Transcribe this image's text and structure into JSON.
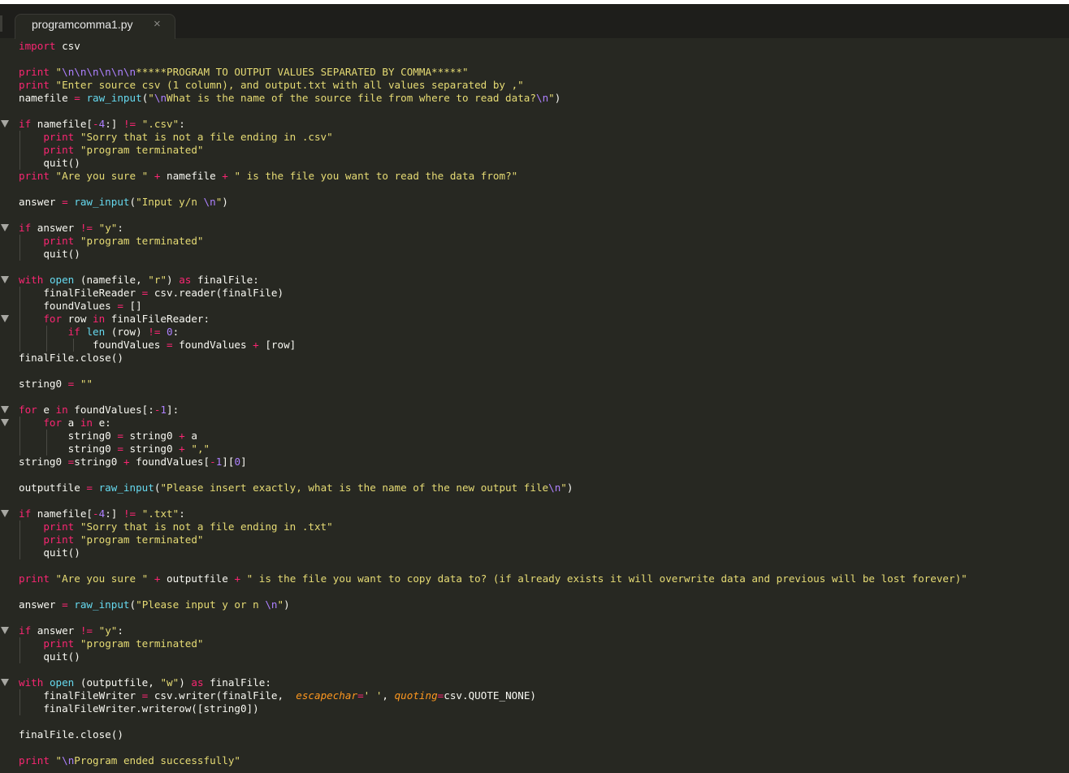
{
  "tab": {
    "filename": "programcomma1.py",
    "close_glyph": "×"
  },
  "code_lines": [
    [
      [
        "kw",
        "import"
      ],
      [
        "tx",
        " csv"
      ]
    ],
    [],
    [
      [
        "kw",
        "print"
      ],
      [
        "tx",
        " "
      ],
      [
        "st",
        "\""
      ],
      [
        "es",
        "\\n\\n\\n\\n\\n\\n"
      ],
      [
        "st",
        "*****PROGRAM TO OUTPUT VALUES SEPARATED BY COMMA*****\""
      ]
    ],
    [
      [
        "kw",
        "print"
      ],
      [
        "tx",
        " "
      ],
      [
        "st",
        "\"Enter source csv (1 column), and output.txt with all values separated by ,\""
      ]
    ],
    [
      [
        "tx",
        "namefile "
      ],
      [
        "op",
        "="
      ],
      [
        "tx",
        " "
      ],
      [
        "fn",
        "raw_input"
      ],
      [
        "tx",
        "("
      ],
      [
        "st",
        "\""
      ],
      [
        "es",
        "\\n"
      ],
      [
        "st",
        "What is the name of the source file from where to read data?"
      ],
      [
        "es",
        "\\n"
      ],
      [
        "st",
        "\""
      ],
      [
        "tx",
        ")"
      ]
    ],
    [],
    [
      [
        "kw",
        "if"
      ],
      [
        "tx",
        " namefile["
      ],
      [
        "op",
        "-"
      ],
      [
        "nm",
        "4"
      ],
      [
        "tx",
        ":] "
      ],
      [
        "op",
        "!="
      ],
      [
        "tx",
        " "
      ],
      [
        "st",
        "\".csv\""
      ],
      [
        "tx",
        ":"
      ]
    ],
    [
      [
        "tx",
        "    "
      ],
      [
        "kw",
        "print"
      ],
      [
        "tx",
        " "
      ],
      [
        "st",
        "\"Sorry that is not a file ending in .csv\""
      ]
    ],
    [
      [
        "tx",
        "    "
      ],
      [
        "kw",
        "print"
      ],
      [
        "tx",
        " "
      ],
      [
        "st",
        "\"program terminated\""
      ]
    ],
    [
      [
        "tx",
        "    quit()"
      ]
    ],
    [
      [
        "kw",
        "print"
      ],
      [
        "tx",
        " "
      ],
      [
        "st",
        "\"Are you sure \""
      ],
      [
        "tx",
        " "
      ],
      [
        "op",
        "+"
      ],
      [
        "tx",
        " namefile "
      ],
      [
        "op",
        "+"
      ],
      [
        "tx",
        " "
      ],
      [
        "st",
        "\" is the file you want to read the data from?\""
      ]
    ],
    [],
    [
      [
        "tx",
        "answer "
      ],
      [
        "op",
        "="
      ],
      [
        "tx",
        " "
      ],
      [
        "fn",
        "raw_input"
      ],
      [
        "tx",
        "("
      ],
      [
        "st",
        "\"Input y/n "
      ],
      [
        "es",
        "\\n"
      ],
      [
        "st",
        "\""
      ],
      [
        "tx",
        ")"
      ]
    ],
    [],
    [
      [
        "kw",
        "if"
      ],
      [
        "tx",
        " answer "
      ],
      [
        "op",
        "!="
      ],
      [
        "tx",
        " "
      ],
      [
        "st",
        "\"y\""
      ],
      [
        "tx",
        ":"
      ]
    ],
    [
      [
        "tx",
        "    "
      ],
      [
        "kw",
        "print"
      ],
      [
        "tx",
        " "
      ],
      [
        "st",
        "\"program terminated\""
      ]
    ],
    [
      [
        "tx",
        "    quit()"
      ]
    ],
    [],
    [
      [
        "kw",
        "with"
      ],
      [
        "tx",
        " "
      ],
      [
        "fn",
        "open"
      ],
      [
        "tx",
        " (namefile, "
      ],
      [
        "st",
        "\"r\""
      ],
      [
        "tx",
        ") "
      ],
      [
        "kw",
        "as"
      ],
      [
        "tx",
        " finalFile:"
      ]
    ],
    [
      [
        "tx",
        "    finalFileReader "
      ],
      [
        "op",
        "="
      ],
      [
        "tx",
        " csv.reader(finalFile)"
      ]
    ],
    [
      [
        "tx",
        "    foundValues "
      ],
      [
        "op",
        "="
      ],
      [
        "tx",
        " []"
      ]
    ],
    [
      [
        "tx",
        "    "
      ],
      [
        "kw",
        "for"
      ],
      [
        "tx",
        " row "
      ],
      [
        "kw",
        "in"
      ],
      [
        "tx",
        " finalFileReader:"
      ]
    ],
    [
      [
        "tx",
        "        "
      ],
      [
        "kw",
        "if"
      ],
      [
        "tx",
        " "
      ],
      [
        "fn",
        "len"
      ],
      [
        "tx",
        " (row) "
      ],
      [
        "op",
        "!="
      ],
      [
        "tx",
        " "
      ],
      [
        "nm",
        "0"
      ],
      [
        "tx",
        ":"
      ]
    ],
    [
      [
        "tx",
        "            foundValues "
      ],
      [
        "op",
        "="
      ],
      [
        "tx",
        " foundValues "
      ],
      [
        "op",
        "+"
      ],
      [
        "tx",
        " [row]"
      ]
    ],
    [
      [
        "tx",
        "finalFile.close()"
      ]
    ],
    [],
    [
      [
        "tx",
        "string0 "
      ],
      [
        "op",
        "="
      ],
      [
        "tx",
        " "
      ],
      [
        "st",
        "\"\""
      ]
    ],
    [],
    [
      [
        "kw",
        "for"
      ],
      [
        "tx",
        " e "
      ],
      [
        "kw",
        "in"
      ],
      [
        "tx",
        " foundValues[:"
      ],
      [
        "op",
        "-"
      ],
      [
        "nm",
        "1"
      ],
      [
        "tx",
        "]:"
      ]
    ],
    [
      [
        "tx",
        "    "
      ],
      [
        "kw",
        "for"
      ],
      [
        "tx",
        " a "
      ],
      [
        "kw",
        "in"
      ],
      [
        "tx",
        " e:"
      ]
    ],
    [
      [
        "tx",
        "        string0 "
      ],
      [
        "op",
        "="
      ],
      [
        "tx",
        " string0 "
      ],
      [
        "op",
        "+"
      ],
      [
        "tx",
        " a"
      ]
    ],
    [
      [
        "tx",
        "        string0 "
      ],
      [
        "op",
        "="
      ],
      [
        "tx",
        " string0 "
      ],
      [
        "op",
        "+"
      ],
      [
        "tx",
        " "
      ],
      [
        "st",
        "\",\""
      ]
    ],
    [
      [
        "tx",
        "string0 "
      ],
      [
        "op",
        "="
      ],
      [
        "tx",
        "string0 "
      ],
      [
        "op",
        "+"
      ],
      [
        "tx",
        " foundValues["
      ],
      [
        "op",
        "-"
      ],
      [
        "nm",
        "1"
      ],
      [
        "tx",
        "]["
      ],
      [
        "nm",
        "0"
      ],
      [
        "tx",
        "]"
      ]
    ],
    [],
    [
      [
        "tx",
        "outputfile "
      ],
      [
        "op",
        "="
      ],
      [
        "tx",
        " "
      ],
      [
        "fn",
        "raw_input"
      ],
      [
        "tx",
        "("
      ],
      [
        "st",
        "\"Please insert exactly, what is the name of the new output file"
      ],
      [
        "es",
        "\\n"
      ],
      [
        "st",
        "\""
      ],
      [
        "tx",
        ")"
      ]
    ],
    [],
    [
      [
        "kw",
        "if"
      ],
      [
        "tx",
        " namefile["
      ],
      [
        "op",
        "-"
      ],
      [
        "nm",
        "4"
      ],
      [
        "tx",
        ":] "
      ],
      [
        "op",
        "!="
      ],
      [
        "tx",
        " "
      ],
      [
        "st",
        "\".txt\""
      ],
      [
        "tx",
        ":"
      ]
    ],
    [
      [
        "tx",
        "    "
      ],
      [
        "kw",
        "print"
      ],
      [
        "tx",
        " "
      ],
      [
        "st",
        "\"Sorry that is not a file ending in .txt\""
      ]
    ],
    [
      [
        "tx",
        "    "
      ],
      [
        "kw",
        "print"
      ],
      [
        "tx",
        " "
      ],
      [
        "st",
        "\"program terminated\""
      ]
    ],
    [
      [
        "tx",
        "    quit()"
      ]
    ],
    [],
    [
      [
        "kw",
        "print"
      ],
      [
        "tx",
        " "
      ],
      [
        "st",
        "\"Are you sure \""
      ],
      [
        "tx",
        " "
      ],
      [
        "op",
        "+"
      ],
      [
        "tx",
        " outputfile "
      ],
      [
        "op",
        "+"
      ],
      [
        "tx",
        " "
      ],
      [
        "st",
        "\" is the file you want to copy data to? (if already exists it will overwrite data and previous will be lost forever)\""
      ]
    ],
    [],
    [
      [
        "tx",
        "answer "
      ],
      [
        "op",
        "="
      ],
      [
        "tx",
        " "
      ],
      [
        "fn",
        "raw_input"
      ],
      [
        "tx",
        "("
      ],
      [
        "st",
        "\"Please input y or n "
      ],
      [
        "es",
        "\\n"
      ],
      [
        "st",
        "\""
      ],
      [
        "tx",
        ")"
      ]
    ],
    [],
    [
      [
        "kw",
        "if"
      ],
      [
        "tx",
        " answer "
      ],
      [
        "op",
        "!="
      ],
      [
        "tx",
        " "
      ],
      [
        "st",
        "\"y\""
      ],
      [
        "tx",
        ":"
      ]
    ],
    [
      [
        "tx",
        "    "
      ],
      [
        "kw",
        "print"
      ],
      [
        "tx",
        " "
      ],
      [
        "st",
        "\"program terminated\""
      ]
    ],
    [
      [
        "tx",
        "    quit()"
      ]
    ],
    [],
    [
      [
        "kw",
        "with"
      ],
      [
        "tx",
        " "
      ],
      [
        "fn",
        "open"
      ],
      [
        "tx",
        " (outputfile, "
      ],
      [
        "st",
        "\"w\""
      ],
      [
        "tx",
        ") "
      ],
      [
        "kw",
        "as"
      ],
      [
        "tx",
        " finalFile:"
      ]
    ],
    [
      [
        "tx",
        "    finalFileWriter "
      ],
      [
        "op",
        "="
      ],
      [
        "tx",
        " csv.writer(finalFile,  "
      ],
      [
        "pa",
        "escapechar"
      ],
      [
        "op",
        "="
      ],
      [
        "st",
        "' '"
      ],
      [
        "tx",
        ", "
      ],
      [
        "pa",
        "quoting"
      ],
      [
        "op",
        "="
      ],
      [
        "tx",
        "csv.QUOTE_NONE)"
      ]
    ],
    [
      [
        "tx",
        "    finalFileWriter.writerow([string0])"
      ]
    ],
    [],
    [
      [
        "tx",
        "finalFile.close()"
      ]
    ],
    [],
    [
      [
        "kw",
        "print"
      ],
      [
        "tx",
        " "
      ],
      [
        "st",
        "\""
      ],
      [
        "es",
        "\\n"
      ],
      [
        "st",
        "Program ended successfully\""
      ]
    ]
  ],
  "fold_lines": [
    6,
    14,
    18,
    21,
    28,
    29,
    36,
    45,
    49
  ],
  "cursor_line": 56,
  "colors": {
    "background": "#272822",
    "keyword": "#f92672",
    "string": "#e6db74",
    "escape_and_number": "#ae81ff",
    "builtin": "#66d9ef",
    "parameter": "#fd971f",
    "text": "#f8f8f2"
  }
}
